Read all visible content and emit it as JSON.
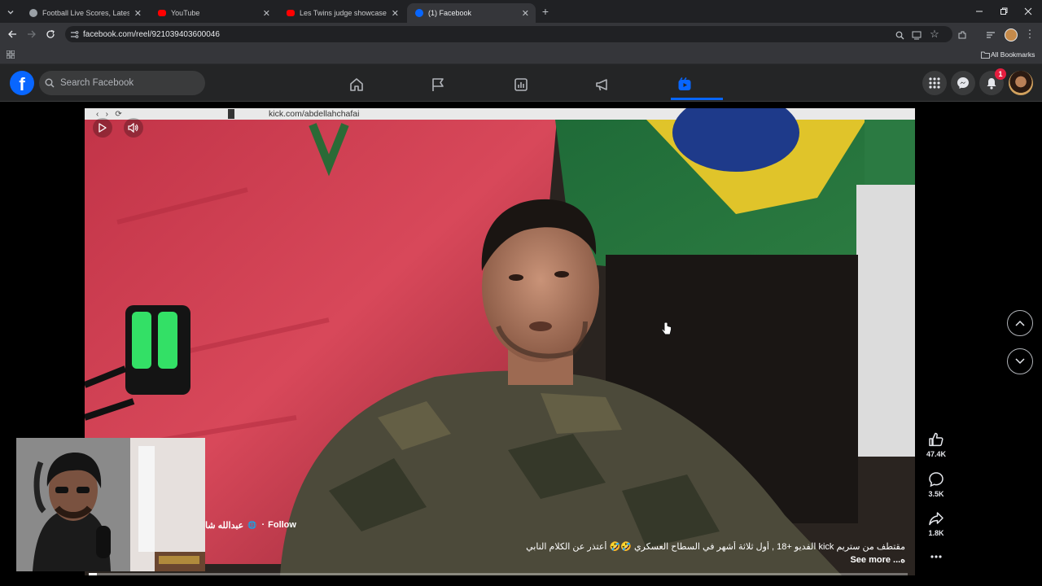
{
  "browser": {
    "tabs": [
      {
        "title": "Football Live Scores, Latest Foo",
        "favicon_color": "#9aa0a6",
        "active": false
      },
      {
        "title": "YouTube",
        "favicon_color": "#ff0000",
        "active": false
      },
      {
        "title": "Les Twins judge showcase | Cy",
        "favicon_color": "#ff0000",
        "active": false
      },
      {
        "title": "(1) Facebook",
        "favicon_color": "#0866ff",
        "active": true
      }
    ],
    "url": "facebook.com/reel/921039403600046",
    "all_bookmarks": "All Bookmarks"
  },
  "facebook": {
    "search_placeholder": "Search Facebook",
    "notification_count": "1",
    "brand_color": "#0866ff"
  },
  "video": {
    "inner_url": "kick.com/abdellahchafai",
    "author": "عبدالله شا",
    "follow_label": "Follow",
    "caption": "مقتطف من ستريم kick الفديو +18 , أول ثلاثة أشهر في السطاح العسكري 🤣🤣 أعتذر عن الكلام النابي",
    "see_more": "See more ...ه",
    "progress": 0.01
  },
  "actions": {
    "likes": "47.4K",
    "comments": "3.5K",
    "shares": "1.8K"
  }
}
